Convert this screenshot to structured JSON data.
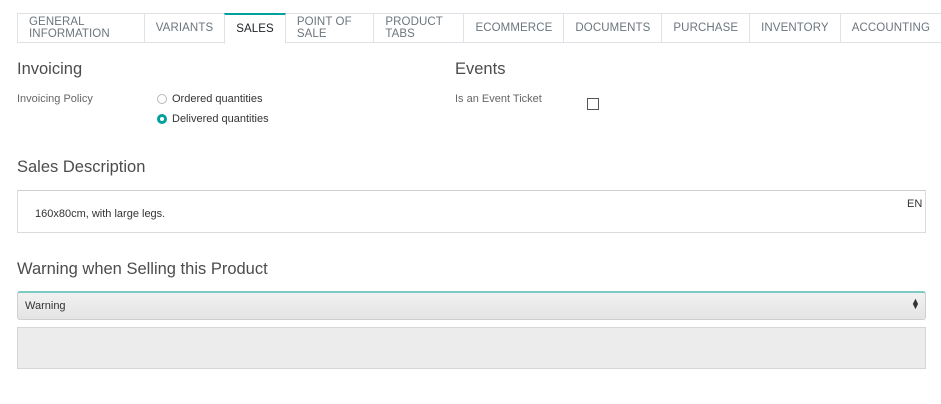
{
  "tabs": [
    {
      "label": "GENERAL INFORMATION",
      "active": false
    },
    {
      "label": "VARIANTS",
      "active": false
    },
    {
      "label": "SALES",
      "active": true
    },
    {
      "label": "POINT OF SALE",
      "active": false
    },
    {
      "label": "PRODUCT TABS",
      "active": false
    },
    {
      "label": "ECOMMERCE",
      "active": false
    },
    {
      "label": "DOCUMENTS",
      "active": false
    },
    {
      "label": "PURCHASE",
      "active": false
    },
    {
      "label": "INVENTORY",
      "active": false
    },
    {
      "label": "ACCOUNTING",
      "active": false
    }
  ],
  "invoicing": {
    "heading": "Invoicing",
    "policy_label": "Invoicing Policy",
    "options": [
      {
        "label": "Ordered quantities",
        "checked": false
      },
      {
        "label": "Delivered quantities",
        "checked": true
      }
    ]
  },
  "events": {
    "heading": "Events",
    "ticket_label": "Is an Event Ticket",
    "ticket_checked": false
  },
  "sales_description": {
    "heading": "Sales Description",
    "value": "160x80cm, with large legs.",
    "lang": "EN"
  },
  "warning": {
    "heading": "Warning when Selling this Product",
    "selected": "Warning",
    "message": ""
  },
  "colors": {
    "accent": "#00a09d"
  }
}
